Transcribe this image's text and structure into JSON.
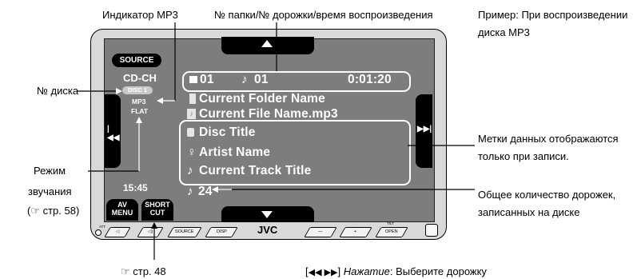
{
  "annotations": {
    "mp3_indicator": "Индикатор MP3",
    "folder_track_time": "№ папки/№ дорожки/время воспроизведения",
    "example_line1": "Пример: При воспроизведении",
    "example_line2": "диска MP3",
    "disc_no": "№ диска",
    "tags_line1": "Метки данных отображаются",
    "tags_line2": "только при записи.",
    "sound_mode_line1": "Режим",
    "sound_mode_line2": "звучания",
    "sound_mode_line3": "(☞ стр. 58)",
    "total_tracks_line1": "Общее количество дорожек,",
    "total_tracks_line2": "записанных на диске",
    "page_ref": "☞ стр. 48",
    "bottom_note_prefix": "[",
    "bottom_note_press": "Нажатие",
    "bottom_note_rest": ": Выберите дорожку"
  },
  "screen": {
    "source_label": "SOURCE",
    "mode": "CD-CH",
    "disc": "DISC 1",
    "format": "MP3",
    "sound_mode": "FLAT",
    "clock": "15:45",
    "av_menu": [
      "AV",
      "MENU"
    ],
    "short_cut": [
      "SHORT",
      "CUT"
    ],
    "folder_no": "01",
    "track_no": "01",
    "play_time": "0:01:20",
    "folder_name": "Current Folder Name",
    "file_name": "Current File Name.mp3",
    "disc_title": "Disc Title",
    "artist_name": "Artist Name",
    "track_title": "Current Track Title",
    "total_tracks": "24"
  },
  "device": {
    "brand": "JVC",
    "buttons": {
      "source": "SOURCE",
      "disp": "DISP",
      "minus": "—",
      "plus": "+",
      "tilt": "TILT",
      "open": "OPEN",
      "att": "ATT"
    }
  }
}
